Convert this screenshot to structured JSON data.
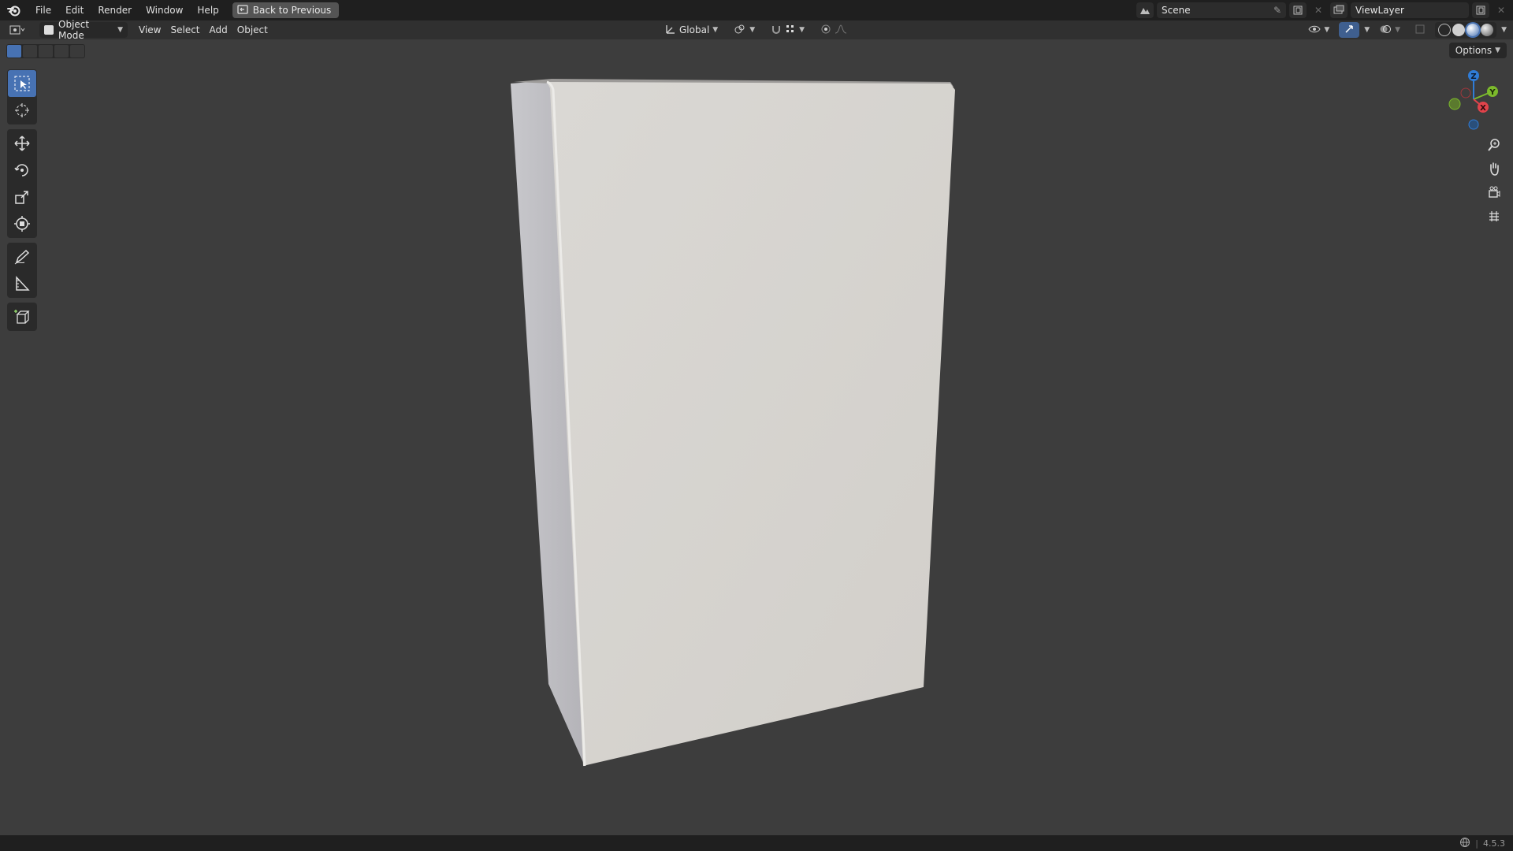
{
  "topbar": {
    "menu": [
      "File",
      "Edit",
      "Render",
      "Window",
      "Help"
    ],
    "back_button": "Back to Previous",
    "scene_name": "Scene",
    "view_layer": "ViewLayer"
  },
  "header": {
    "mode": "Object Mode",
    "menu": [
      "View",
      "Select",
      "Add",
      "Object"
    ],
    "transform_orientation": "Global",
    "options_label": "Options"
  },
  "gizmo": {
    "z_label": "Z",
    "y_label": "Y",
    "x_label": "X",
    "x_color": "#e0434b",
    "y_color": "#7cba2c",
    "z_color": "#2f7cd6"
  },
  "toolbar": {
    "tools": [
      "select-box",
      "cursor",
      "move",
      "rotate",
      "scale",
      "transform",
      "annotate",
      "measure",
      "add-cube"
    ],
    "active_tool": "select-box"
  },
  "colors": {
    "accent": "#4772b3",
    "viewport_bg": "#3d3d3d",
    "object_front": "#d6d3ce",
    "object_side": "#bdbcc0"
  },
  "status": {
    "version": "4.5.3"
  }
}
